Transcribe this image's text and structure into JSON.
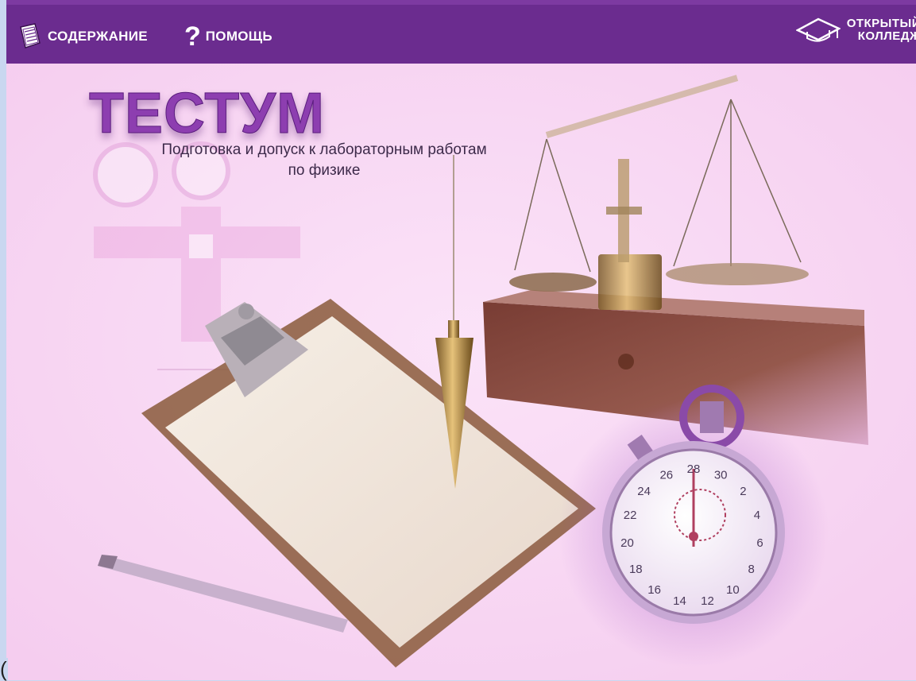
{
  "header": {
    "contents_label": "СОДЕРЖАНИЕ",
    "help_label": "ПОМОЩЬ",
    "help_icon_glyph": "?",
    "brand_line1": "ОТКРЫТЫЙ",
    "brand_line2": "КОЛЛЕДЖ",
    "background_color": "#6b2c8f"
  },
  "hero": {
    "title": "ТЕСТУМ",
    "subtitle_line1": "Подготовка и допуск к лабораторным работам",
    "subtitle_line2": "по физике",
    "background_color": "#f7d3f2"
  },
  "stopwatch": {
    "dial_numbers": [
      "28",
      "30",
      "2",
      "4",
      "6",
      "8",
      "10",
      "12",
      "14",
      "16",
      "18",
      "20",
      "22",
      "24",
      "26"
    ]
  },
  "stray_text": "("
}
